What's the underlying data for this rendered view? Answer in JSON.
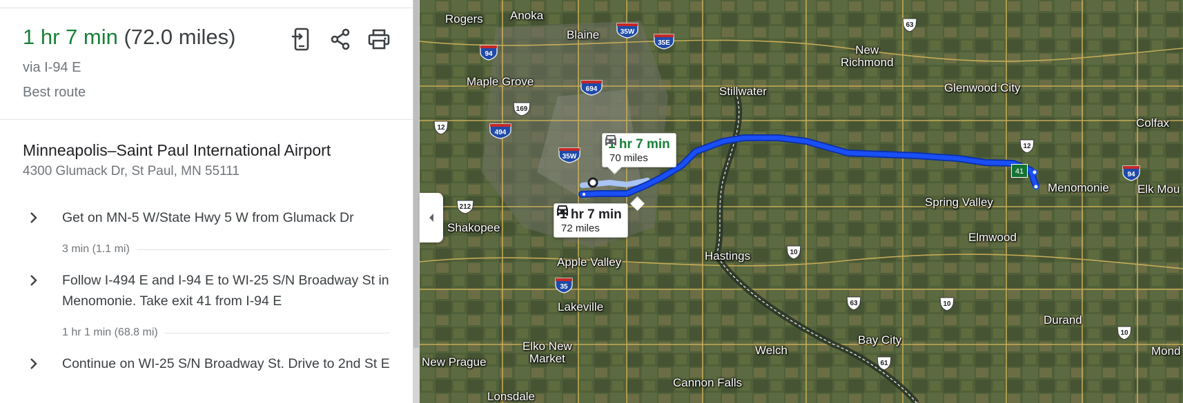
{
  "summary": {
    "duration": "1 hr 7 min",
    "distance": "(72.0 miles)",
    "via": "via I-94 E",
    "route_note": "Best route"
  },
  "actions": [
    {
      "name": "send-to-phone",
      "icon": "send-to-phone-icon"
    },
    {
      "name": "share",
      "icon": "share-icon"
    },
    {
      "name": "print",
      "icon": "print-icon"
    }
  ],
  "origin": {
    "name": "Minneapolis–Saint Paul International Airport",
    "address": "4300 Glumack Dr, St Paul, MN 55111"
  },
  "steps": [
    {
      "text": "Get on MN-5 W/State Hwy 5 W from Glumack Dr",
      "meta": "3 min (1.1 mi)"
    },
    {
      "text": "Follow I-494 E and I-94 E to WI-25 S/N Broadway St in Menomonie. Take exit 41 from I-94 E",
      "meta": "1 hr 1 min (68.8 mi)"
    },
    {
      "text": "Continue on WI-25 S/N Broadway St. Drive to 2nd St E",
      "meta": ""
    }
  ],
  "map": {
    "callouts": {
      "selected": {
        "time": "1 hr 7 min",
        "distance": "70 miles"
      },
      "alternate": {
        "time": "1 hr 7 min",
        "distance": "72 miles"
      }
    },
    "cities": {
      "rogers": "Rogers",
      "anoka": "Anoka",
      "blaine": "Blaine",
      "new_richmond": "New\nRichmond",
      "maple_grove": "Maple Grove",
      "stillwater": "Stillwater",
      "glenwood_city": "Glenwood City",
      "colfax": "Colfax",
      "shakopee": "Shakopee",
      "spring_valley": "Spring Valley",
      "menomonie": "Menomonie",
      "elk_mound": "Elk Mou",
      "apple_valley": "Apple Valley",
      "hastings": "Hastings",
      "elmwood": "Elmwood",
      "lakeville": "Lakeville",
      "elko_new_market": "Elko New\nMarket",
      "new_prague": "New Prague",
      "welch": "Welch",
      "bay_city": "Bay City",
      "durand": "Durand",
      "mond": "Mond",
      "cannon_falls": "Cannon Falls",
      "lonsdale": "Lonsdale"
    },
    "shields": {
      "i94_west": "94",
      "i35w_north": "35W",
      "i35e": "35E",
      "i694": "694",
      "i494": "494",
      "i35w_south": "35W",
      "i35": "35",
      "i94_east": "94",
      "exit41": "41",
      "us63_north": "63",
      "us169": "169",
      "us12_west": "12",
      "us12_east": "12",
      "us212": "212",
      "us10_west": "10",
      "us10_mid": "10",
      "us10_east": "10",
      "us63_south": "63",
      "us61": "61"
    },
    "colors": {
      "route": "#1a4ff5",
      "route_outline": "#0b2fa8",
      "alt_route": "#a9c4f5",
      "green_time": "#188038"
    }
  }
}
